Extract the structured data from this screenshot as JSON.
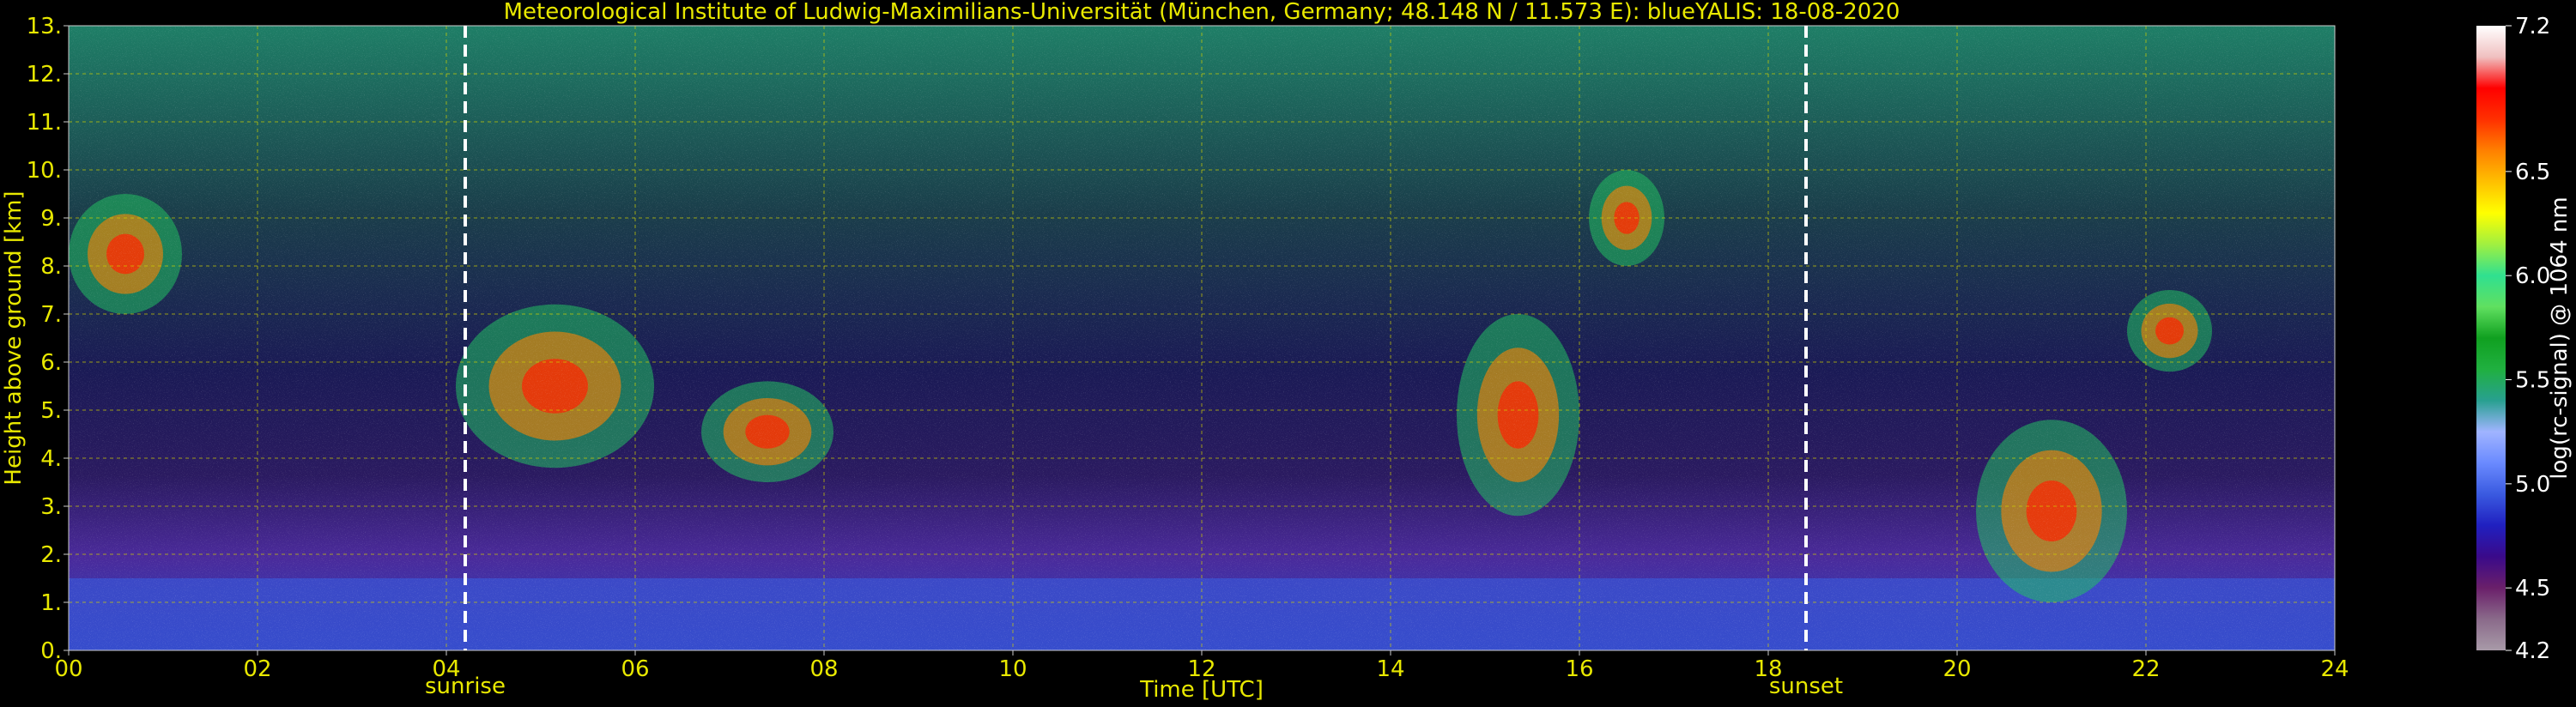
{
  "chart_data": {
    "type": "heatmap",
    "title": "Meteorological Institute of Ludwig-Maximilians-Universität (München, Germany; 48.148 N / 11.573 E):    blueYALIS: 18-08-2020",
    "xlabel": "Time [UTC]",
    "ylabel": "Height above ground [km]",
    "colorbar_label": "log(rc-signal) @ 1064 nm",
    "xlim": [
      0,
      24
    ],
    "ylim": [
      0,
      13
    ],
    "clim": [
      4.2,
      7.2
    ],
    "x_ticks": [
      "00",
      "02",
      "04",
      "06",
      "08",
      "10",
      "12",
      "14",
      "16",
      "18",
      "20",
      "22",
      "24"
    ],
    "y_ticks": [
      "0.",
      "1.",
      "2.",
      "3.",
      "4.",
      "5.",
      "6.",
      "7.",
      "8.",
      "9.",
      "10.",
      "11.",
      "12.",
      "13."
    ],
    "colorbar_ticks": [
      "4.2",
      "4.5",
      "5.0",
      "5.5",
      "6.0",
      "6.5",
      "7.2"
    ],
    "grid": true,
    "annotations": [
      {
        "text": "sunrise",
        "x": 4.2
      },
      {
        "text": "sunset",
        "x": 18.4
      }
    ],
    "colormap": [
      "#a89aa8",
      "#8a6a8a",
      "#6a1f6a",
      "#3a0a8a",
      "#2020c0",
      "#3a5ae0",
      "#6a8aff",
      "#a0b4ff",
      "#28a090",
      "#20b040",
      "#10a020",
      "#60e060",
      "#30e090",
      "#a0f040",
      "#ffff00",
      "#ffc000",
      "#ff8000",
      "#ff3000",
      "#ff0000",
      "#f0c0c0",
      "#ffffff"
    ],
    "features": [
      {
        "kind": "boundary_layer",
        "t_start": 0,
        "t_end": 24,
        "top_km": 1.5
      },
      {
        "kind": "cloud",
        "t_start": 0.0,
        "t_end": 1.2,
        "base_km": 7.0,
        "top_km": 9.5
      },
      {
        "kind": "cloud",
        "t_start": 4.1,
        "t_end": 6.2,
        "base_km": 3.8,
        "top_km": 7.2
      },
      {
        "kind": "cloud",
        "t_start": 6.7,
        "t_end": 8.1,
        "base_km": 3.5,
        "top_km": 5.6
      },
      {
        "kind": "cloud",
        "t_start": 14.7,
        "t_end": 16.0,
        "base_km": 2.8,
        "top_km": 7.0
      },
      {
        "kind": "cloud",
        "t_start": 16.1,
        "t_end": 16.9,
        "base_km": 8.0,
        "top_km": 10.0
      },
      {
        "kind": "cloud",
        "t_start": 20.2,
        "t_end": 21.8,
        "base_km": 1.0,
        "top_km": 4.8
      },
      {
        "kind": "cloud",
        "t_start": 21.8,
        "t_end": 22.7,
        "base_km": 5.8,
        "top_km": 7.5
      }
    ]
  }
}
